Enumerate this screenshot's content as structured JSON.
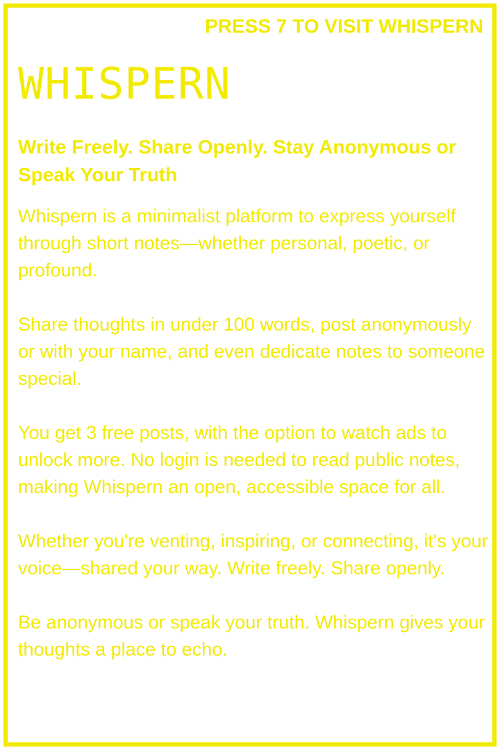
{
  "header": {
    "cta_label": "PRESS 7 TO VISIT WHISPERN"
  },
  "brand": {
    "name": "WHISPERN"
  },
  "tagline": "Write Freely. Share Openly. Stay Anonymous or Speak Your Truth",
  "paragraphs": [
    "Whispern is a minimalist platform to express yourself through short notes—whether personal, poetic, or profound.",
    "Share thoughts in under 100 words, post anonymously or with your name, and even dedicate notes to someone special.",
    "You get 3 free posts, with the option to watch ads to unlock more. No login is needed to read public notes, making Whispern an open, accessible space for all.",
    "Whether you're venting, inspiring, or connecting, it's your voice—shared your way. Write freely. Share openly.",
    "Be anonymous or speak your truth. Whispern gives your thoughts a place to echo."
  ],
  "colors": {
    "accent": "#f2ea00",
    "background": "#ffffff"
  }
}
